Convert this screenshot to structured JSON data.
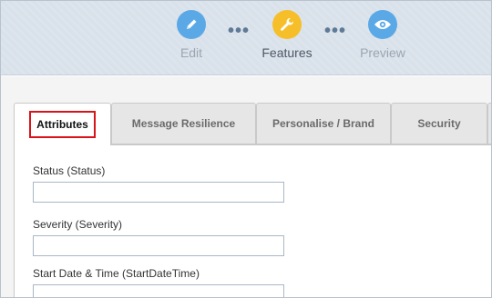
{
  "stepper": {
    "steps": [
      {
        "label": "Edit",
        "icon": "pencil-icon",
        "color": "#5aa9e6"
      },
      {
        "label": "Features",
        "icon": "wrench-icon",
        "color": "#f6bf2a"
      },
      {
        "label": "Preview",
        "icon": "eye-icon",
        "color": "#5aa9e6"
      }
    ],
    "separator": "•••"
  },
  "tabs": [
    {
      "label": "Attributes"
    },
    {
      "label": "Message Resilience"
    },
    {
      "label": "Personalise / Brand"
    },
    {
      "label": "Security"
    }
  ],
  "form": {
    "fields": [
      {
        "label": "Status (Status)",
        "value": ""
      },
      {
        "label": "Severity (Severity)",
        "value": ""
      },
      {
        "label": "Start Date & Time (StartDateTime)",
        "value": ""
      }
    ]
  },
  "colors": {
    "highlight": "#d8141b",
    "header_bg": "#d9e1ea"
  }
}
